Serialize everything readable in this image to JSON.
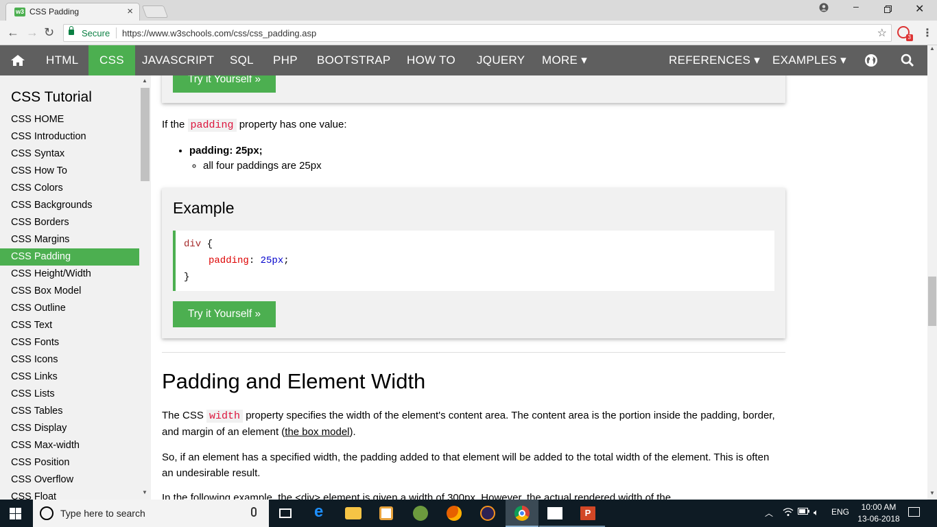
{
  "browser": {
    "tab_title": "CSS Padding",
    "tab_favicon": "w3",
    "tab_close": "×",
    "secure_label": "Secure",
    "url": "https://www.w3schools.com/css/css_padding.asp",
    "extension_badge": "3"
  },
  "topnav": {
    "items": [
      "HTML",
      "CSS",
      "JAVASCRIPT",
      "SQL",
      "PHP",
      "BOOTSTRAP",
      "HOW TO",
      "JQUERY",
      "MORE ▾",
      "REFERENCES ▾",
      "EXAMPLES ▾"
    ],
    "active": "CSS",
    "accent": "#4caf50",
    "bg": "#5f5f5f"
  },
  "sidebar": {
    "heading": "CSS Tutorial",
    "links": [
      "CSS HOME",
      "CSS Introduction",
      "CSS Syntax",
      "CSS How To",
      "CSS Colors",
      "CSS Backgrounds",
      "CSS Borders",
      "CSS Margins",
      "CSS Padding",
      "CSS Height/Width",
      "CSS Box Model",
      "CSS Outline",
      "CSS Text",
      "CSS Fonts",
      "CSS Icons",
      "CSS Links",
      "CSS Lists",
      "CSS Tables",
      "CSS Display",
      "CSS Max-width",
      "CSS Position",
      "CSS Overflow",
      "CSS Float"
    ],
    "active": "CSS Padding"
  },
  "main": {
    "try_label": "Try it Yourself »",
    "one_value_intro": {
      "before": "If the ",
      "code": "padding",
      "after": " property has one value:"
    },
    "bullet_bold": "padding: 25px;",
    "bullet_sub": "all four paddings are 25px",
    "example": {
      "title": "Example",
      "selector": "div",
      "open_brace": " {",
      "property": "padding",
      "colon": ": ",
      "value": "25px",
      "semicolon": ";",
      "close_brace": "}"
    },
    "section_heading": "Padding and Element Width",
    "width_para": {
      "before": "The CSS ",
      "code": "width",
      "after": " property specifies the width of the element's content area. The content area is the portion inside the padding, border, and margin of an element (",
      "link": "the box model",
      "end": ")."
    },
    "so_para": "So, if an element has a specified width, the padding added to that element will be added to the total width of the element. This is often an undesirable result.",
    "cut_para": "In the following example, the <div> element is given a width of 300px. However, the actual rendered width of the"
  },
  "taskbar": {
    "search_placeholder": "Type here to search",
    "lang": "ENG",
    "time": "10:00 AM",
    "date": "13-06-2018"
  }
}
